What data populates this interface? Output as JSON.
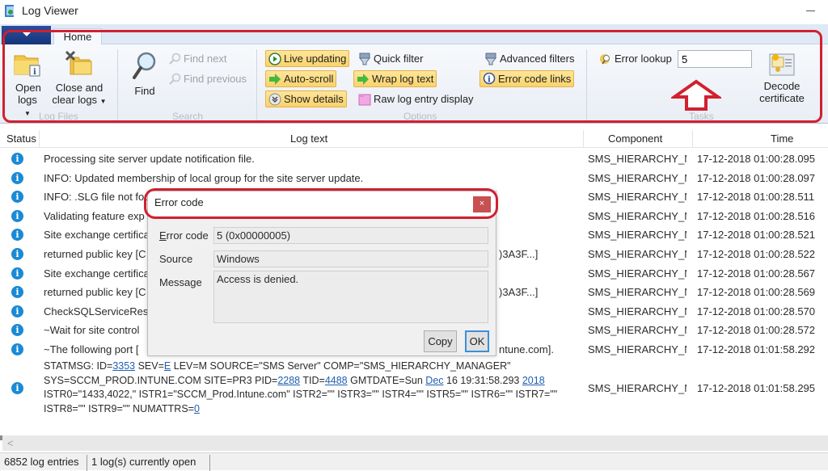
{
  "window": {
    "title": "Log Viewer"
  },
  "ribbon": {
    "tab": "Home",
    "groups": {
      "log_files": {
        "label": "Log Files",
        "open_logs": "Open logs",
        "close_logs_line1": "Close and",
        "close_logs_line2": "clear logs"
      },
      "search": {
        "label": "Search",
        "find": "Find",
        "find_next": "Find next",
        "find_previous": "Find previous"
      },
      "options": {
        "label": "Options",
        "live_updating": "Live updating",
        "auto_scroll": "Auto-scroll",
        "show_details": "Show details",
        "quick_filter": "Quick filter",
        "wrap_log_text": "Wrap log text",
        "raw_log_entry_display": "Raw log entry display",
        "advanced_filters": "Advanced filters",
        "error_code_links": "Error code links"
      },
      "tasks": {
        "label": "Tasks",
        "error_lookup_label": "Error lookup",
        "error_lookup_value": "5",
        "decode_line1": "Decode",
        "decode_line2": "certificate"
      }
    }
  },
  "table": {
    "columns": [
      "Status",
      "Log text",
      "Component",
      "Time"
    ],
    "rows": [
      {
        "text": "Processing site server update notification file.",
        "tail": "",
        "component": "SMS_HIERARCHY_M.",
        "time": "17-12-2018 01:00:28.095"
      },
      {
        "text": "INFO: Updated membership of local group for the site server update.",
        "tail": "",
        "component": "SMS_HIERARCHY_M.",
        "time": "17-12-2018 01:00:28.097"
      },
      {
        "text": "INFO: .SLG file not fou",
        "tail": "",
        "component": "SMS_HIERARCHY_M.",
        "time": "17-12-2018 01:00:28.511"
      },
      {
        "text": "Validating feature exp",
        "tail": "",
        "component": "SMS_HIERARCHY_M.",
        "time": "17-12-2018 01:00:28.516"
      },
      {
        "text": "Site exchange certifica",
        "tail": "",
        "component": "SMS_HIERARCHY_M.",
        "time": "17-12-2018 01:00:28.521"
      },
      {
        "text": "returned public key [C",
        "tail": ")3A3F...]",
        "component": "SMS_HIERARCHY_M.",
        "time": "17-12-2018 01:00:28.522"
      },
      {
        "text": "Site exchange certifica",
        "tail": "",
        "component": "SMS_HIERARCHY_M.",
        "time": "17-12-2018 01:00:28.567"
      },
      {
        "text": "returned public key [C",
        "tail": ")3A3F...]",
        "component": "SMS_HIERARCHY_M.",
        "time": "17-12-2018 01:00:28.569"
      },
      {
        "text": "CheckSQLServiceRest",
        "tail": "",
        "component": "SMS_HIERARCHY_M.",
        "time": "17-12-2018 01:00:28.570"
      },
      {
        "text": "~Wait for site control",
        "tail": "",
        "component": "SMS_HIERARCHY_M.",
        "time": "17-12-2018 01:00:28.572"
      },
      {
        "text": "~The following port [",
        "tail": "ntune.com].",
        "component": "SMS_HIERARCHY_M.",
        "time": "17-12-2018 01:01:58.292"
      }
    ],
    "statmsg": {
      "component": "SMS_HIERARCHY_M.",
      "time": "17-12-2018 01:01:58.295",
      "p1": "STATMSG: ID=",
      "id": "3353",
      "p2": " SEV=",
      "sev": "E",
      "p3": " LEV=M SOURCE=\"SMS Server\" COMP=\"SMS_HIERARCHY_MANAGER\" SYS=SCCM_PROD.INTUNE.COM SITE=PR3 PID=",
      "pid": "2288",
      "p4": " TID=",
      "tid": "4488",
      "p5": " GMTDATE=Sun ",
      "month": "Dec",
      "p6": " 16 19:31:58.293 ",
      "year": "2018",
      "p7": " ISTR0=\"1433,4022,\" ISTR1=\"SCCM_Prod.Intune.com\" ISTR2=\"\" ISTR3=\"\" ISTR4=\"\" ISTR5=\"\" ISTR6=\"\" ISTR7=\"\" ISTR8=\"\" ISTR9=\"\" NUMATTRS=",
      "numattrs": "0"
    }
  },
  "status_bar": {
    "entries": "6852 log entries",
    "open_logs": "1 log(s) currently open"
  },
  "dialog": {
    "title": "Error code",
    "close": "×",
    "error_code_label": "Error code",
    "error_code_value": "5 (0x00000005)",
    "source_label": "Source",
    "source_value": "Windows",
    "message_label": "Message",
    "message_value": "Access is denied.",
    "copy": "Copy",
    "ok": "OK"
  },
  "colors": {
    "annotation_red": "#d12030",
    "info_blue": "#1a8ad4",
    "toggle_on": "#fbd36b",
    "link_blue": "#1f5fb5"
  }
}
